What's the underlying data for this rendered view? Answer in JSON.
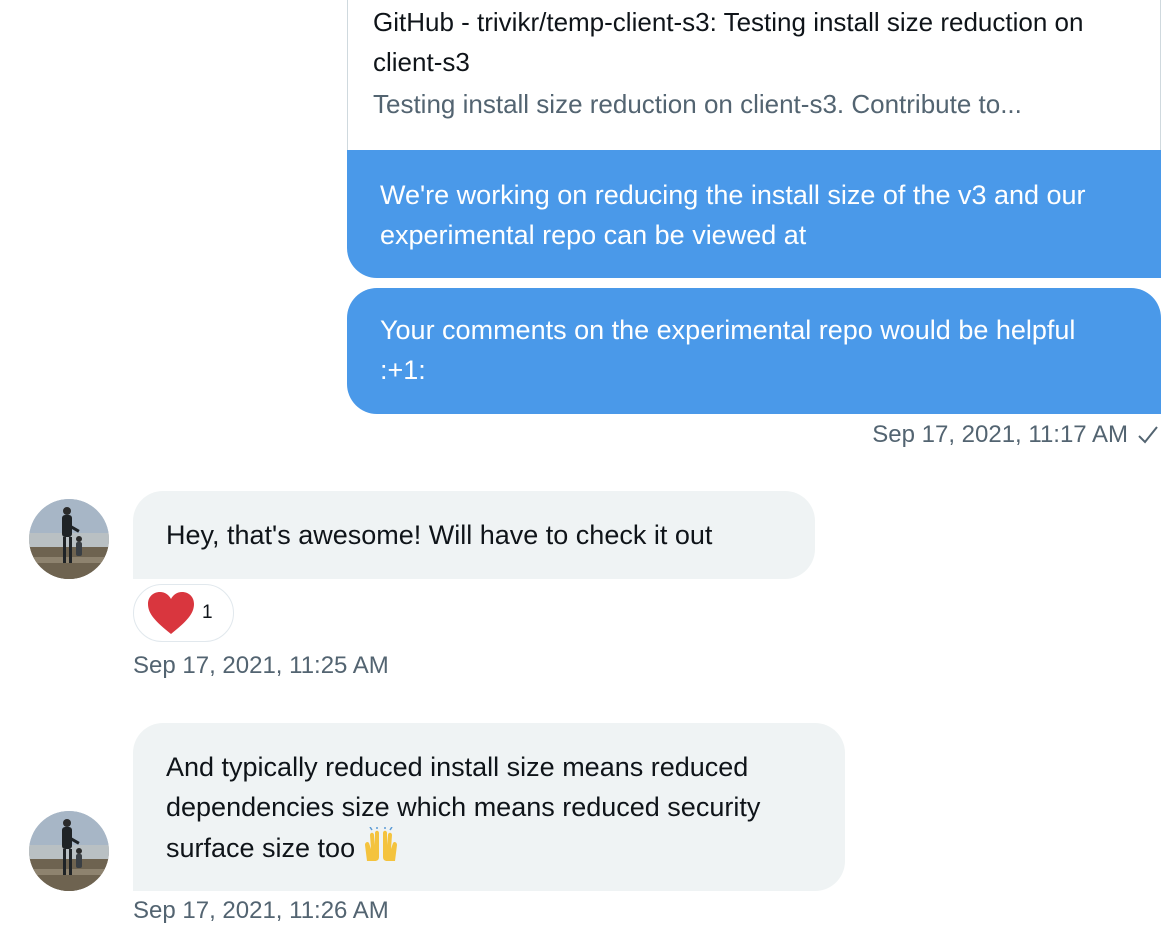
{
  "link_card": {
    "title": "GitHub - trivikr/temp-client-s3: Testing install size reduction on client-s3",
    "description": "Testing install size reduction on client-s3. Contribute to..."
  },
  "sent_messages": [
    {
      "text": "We're working on reducing the install size of the v3 and our experimental repo can be viewed at"
    },
    {
      "text": "Your comments on the experimental repo would be helpful :+1:"
    }
  ],
  "sent_timestamp": "Sep 17, 2021, 11:17 AM",
  "received_messages": [
    {
      "text": "Hey, that's awesome! Will have to check it out",
      "reaction": {
        "icon": "heart-icon",
        "count": "1",
        "color": "#d9363e"
      },
      "timestamp": "Sep 17, 2021, 11:25 AM"
    },
    {
      "text": "And typically reduced install size means reduced dependencies size which means reduced security surface size too",
      "emoji": "raising-hands-icon",
      "timestamp": "Sep 17, 2021, 11:26 AM"
    }
  ],
  "colors": {
    "sent_bubble": "#4a99e9",
    "received_bubble": "#eff3f4",
    "secondary_text": "#536471"
  }
}
